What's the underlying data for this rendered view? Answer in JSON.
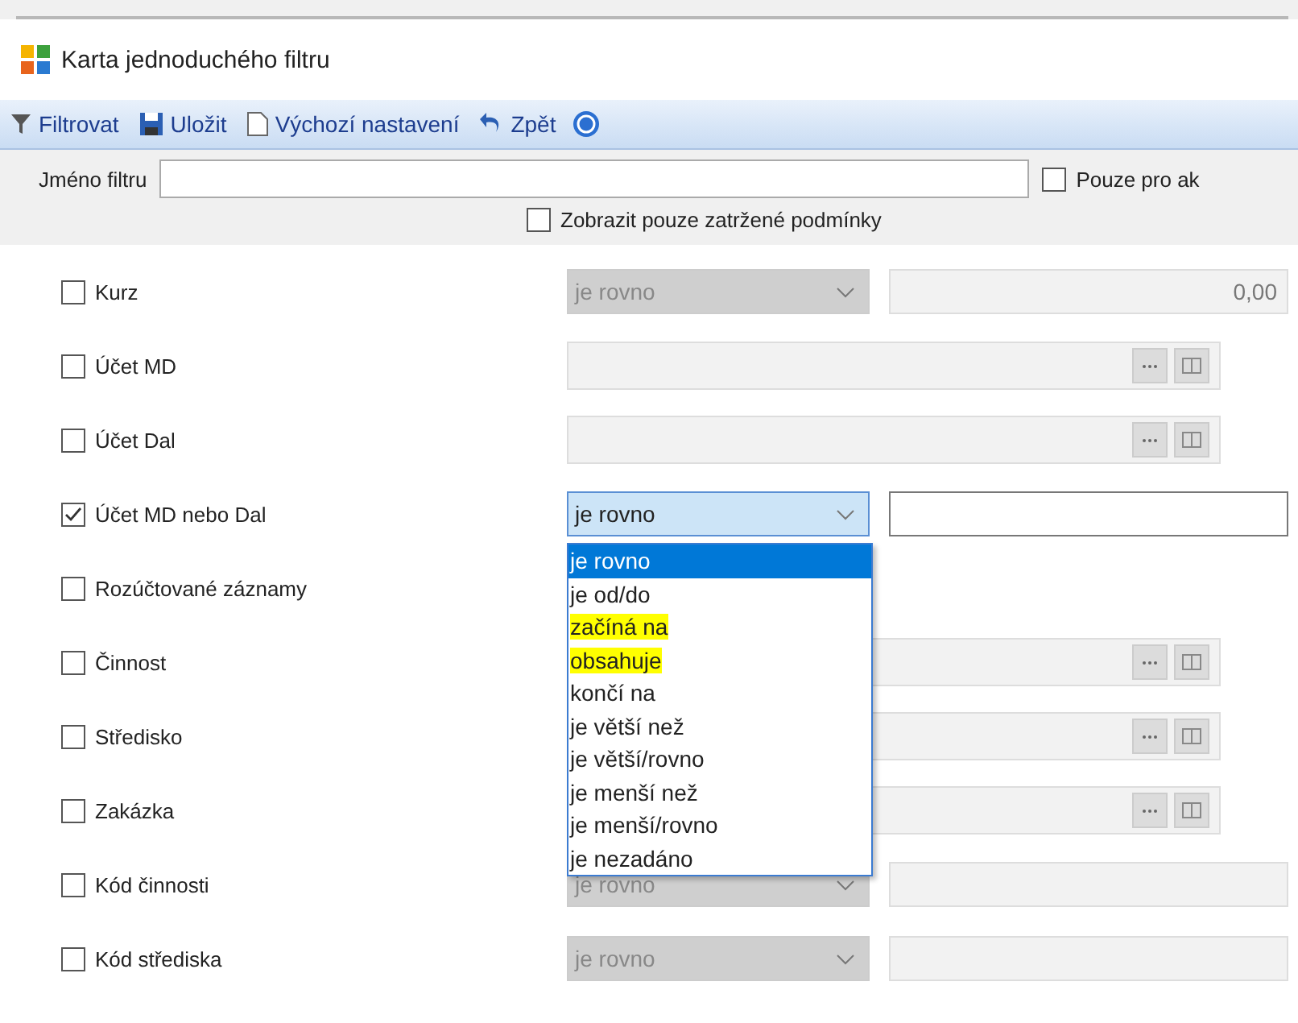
{
  "window": {
    "title": "Karta jednoduchého filtru"
  },
  "toolbar": [
    {
      "kind": "filter",
      "label": "Filtrovat"
    },
    {
      "kind": "save",
      "label": "Uložit"
    },
    {
      "kind": "document",
      "label": "Výchozí nastavení"
    },
    {
      "kind": "undo",
      "label": "Zpět"
    },
    {
      "kind": "help"
    }
  ],
  "filter_name": {
    "label": "Jméno filtru"
  },
  "only_for": {
    "label": "Pouze pro ak",
    "checked": false
  },
  "show_checked_only": {
    "label": "Zobrazit pouze zatržené podmínky",
    "checked": false
  },
  "conditions": [
    {
      "label": "Kurz",
      "checked": false,
      "kind": "select_value",
      "operator": "je rovno",
      "value": "0,00"
    },
    {
      "label": "Účet MD",
      "checked": false,
      "kind": "picker"
    },
    {
      "label": "Účet Dal",
      "checked": false,
      "kind": "picker"
    },
    {
      "label": "Účet MD nebo Dal",
      "checked": true,
      "kind": "select_value",
      "operator": "je rovno",
      "expanded": true,
      "options": [
        {
          "label": "je rovno",
          "selected": true,
          "highlighted": false
        },
        {
          "label": "je od/do",
          "selected": false,
          "highlighted": false
        },
        {
          "label": "začíná na",
          "selected": false,
          "highlighted": true
        },
        {
          "label": "obsahuje",
          "selected": false,
          "highlighted": true
        },
        {
          "label": "končí na",
          "selected": false,
          "highlighted": false
        },
        {
          "label": "je větší než",
          "selected": false,
          "highlighted": false
        },
        {
          "label": "je větší/rovno",
          "selected": false,
          "highlighted": false
        },
        {
          "label": "je menší než",
          "selected": false,
          "highlighted": false
        },
        {
          "label": "je menší/rovno",
          "selected": false,
          "highlighted": false
        },
        {
          "label": "je nezadáno",
          "selected": false,
          "highlighted": false
        }
      ]
    },
    {
      "label": "Rozúčtované záznamy",
      "checked": false,
      "kind": "flag"
    },
    {
      "label": "Činnost",
      "checked": false,
      "kind": "picker"
    },
    {
      "label": "Středisko",
      "checked": false,
      "kind": "picker"
    },
    {
      "label": "Zakázka",
      "checked": false,
      "kind": "picker"
    },
    {
      "label": "Kód činnosti",
      "checked": false,
      "kind": "select_value",
      "operator": "je rovno"
    },
    {
      "label": "Kód střediska",
      "checked": false,
      "kind": "select_value",
      "operator": "je rovno"
    }
  ]
}
